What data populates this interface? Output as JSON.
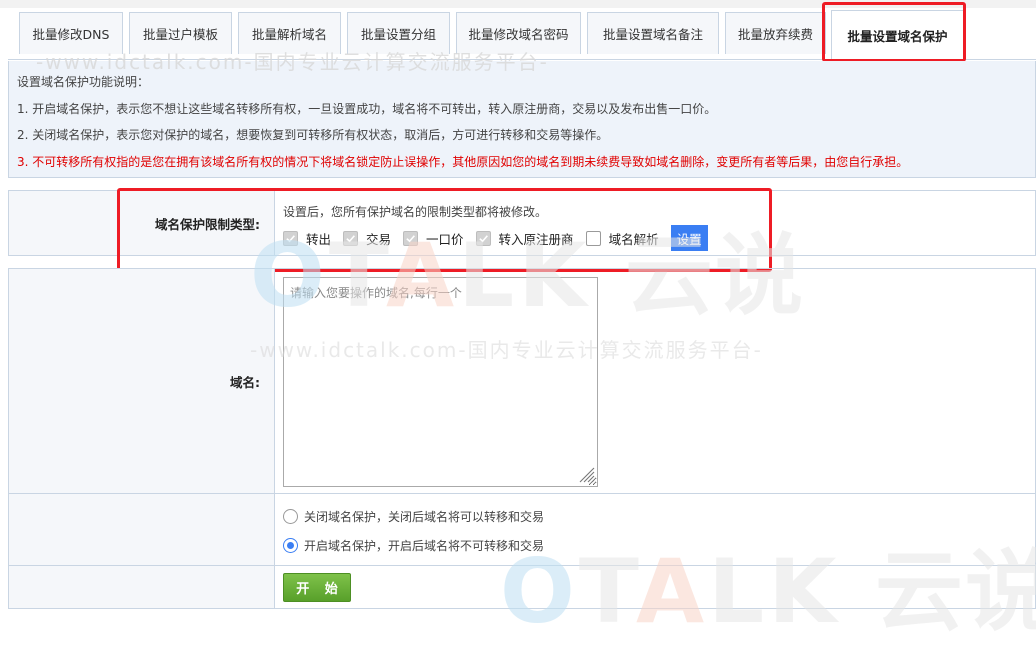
{
  "tabs": [
    {
      "label": "批量修改DNS",
      "active": false
    },
    {
      "label": "批量过户模板",
      "active": false
    },
    {
      "label": "批量解析域名",
      "active": false
    },
    {
      "label": "批量设置分组",
      "active": false
    },
    {
      "label": "批量修改域名密码",
      "active": false
    },
    {
      "label": "批量设置域名备注",
      "active": false
    },
    {
      "label": "批量放弃续费",
      "active": false
    },
    {
      "label": "批量设置域名保护",
      "active": true
    }
  ],
  "info": {
    "title": "设置域名保护功能说明：",
    "line1": "1. 开启域名保护，表示您不想让这些域名转移所有权，一旦设置成功，域名将不可转出，转入原注册商，交易以及发布出售一口价。",
    "line2": "2. 关闭域名保护，表示您对保护的域名，想要恢复到可转移所有权状态，取消后，方可进行转移和交易等操作。",
    "line3": "3. 不可转移所有权指的是您在拥有该域名所有权的情况下将域名锁定防止误操作，其他原因如您的域名到期未续费导致如域名删除，变更所有者等后果，由您自行承担。"
  },
  "protect_type": {
    "label": "域名保护限制类型:",
    "hint": "设置后，您所有保护域名的限制类型都将被修改。",
    "options": [
      {
        "label": "转出",
        "checked": true
      },
      {
        "label": "交易",
        "checked": true
      },
      {
        "label": "一口价",
        "checked": true
      },
      {
        "label": "转入原注册商",
        "checked": true
      },
      {
        "label": "域名解析",
        "checked": false
      }
    ],
    "set_button": "设置"
  },
  "domain": {
    "label": "域名:",
    "placeholder": "请输入您要操作的域名,每行一个",
    "value": ""
  },
  "protection_mode": {
    "options": [
      {
        "label": "关闭域名保护，关闭后域名将可以转移和交易",
        "selected": false
      },
      {
        "label": "开启域名保护，开启后域名将不可转移和交易",
        "selected": true
      }
    ]
  },
  "start_button": "开 始",
  "watermark": {
    "logo_o": "O",
    "logo_t": "T",
    "logo_a": "A",
    "logo_lk": "LK",
    "logo_cn": "云说",
    "url": "-www.idctalk.com-国内专业云计算交流服务平台-"
  },
  "colors": {
    "accent_blue": "#3a7ef3",
    "warning_red": "#e00000",
    "highlight_red": "#ee1c25",
    "start_green": "#6ab03a"
  }
}
